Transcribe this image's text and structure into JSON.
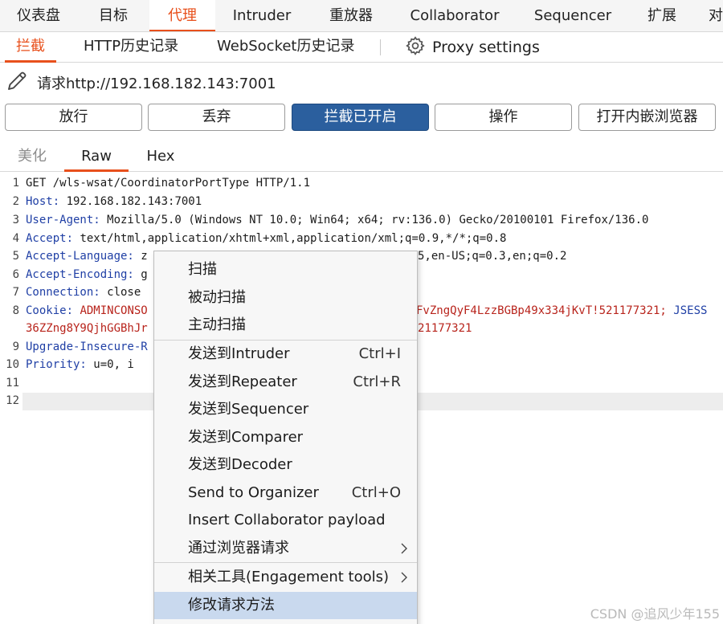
{
  "top_tabs": [
    {
      "label": "仪表盘"
    },
    {
      "label": "目标"
    },
    {
      "label": "代理"
    },
    {
      "label": "Intruder"
    },
    {
      "label": "重放器"
    },
    {
      "label": "Collaborator"
    },
    {
      "label": "Sequencer"
    },
    {
      "label": "扩展"
    },
    {
      "label": "对"
    }
  ],
  "active_top_tab": "代理",
  "sub_tabs": [
    {
      "label": "拦截"
    },
    {
      "label": "HTTP历史记录"
    },
    {
      "label": "WebSocket历史记录"
    }
  ],
  "active_sub_tab": "拦截",
  "proxy_settings": {
    "icon": "gear-icon",
    "label": "Proxy settings"
  },
  "request": {
    "icon": "pencil-icon",
    "label": "请求http://192.168.182.143:7001"
  },
  "buttons": {
    "forward": "放行",
    "drop": "丢弃",
    "intercept": "拦截已开启",
    "action": "操作",
    "browser": "打开内嵌浏览器"
  },
  "editor_tabs": [
    {
      "label": "美化"
    },
    {
      "label": "Raw"
    },
    {
      "label": "Hex"
    }
  ],
  "active_editor_tab": "Raw",
  "gutter": [
    "1",
    "2",
    "3",
    "4",
    "5",
    "6",
    "7",
    "8",
    "",
    "9",
    "10",
    "11",
    "12"
  ],
  "code": {
    "line1": "GET /wls-wsat/CoordinatorPortType HTTP/1.1",
    "line2_name": "Host:",
    "line2_value": " 192.168.182.143:7001",
    "line3_name": "User-Agent:",
    "line3_value": " Mozilla/5.0 (Windows NT 10.0; Win64; x64; rv:136.0) Gecko/20100101 Firefox/136.0",
    "line4_name": "Accept:",
    "line4_value": " text/html,application/xhtml+xml,application/xml;q=0.9,*/*;q=0.8",
    "line5_name": "Accept-Language:",
    "line5_value_left": " z",
    "line5_value_right": "5,en-US;q=0.3,en;q=0.2",
    "line6_name": "Accept-Encoding:",
    "line6_value": " g",
    "line7_name": "Connection:",
    "line7_value": " close",
    "line8_name": "Cookie:",
    "line8_value_left": " ADMINCONSO",
    "line8_value_right": "FvZngQyF4LzzBGBp49x334jKvT!521177321; ",
    "line8_name2": "JSESS",
    "line8b_left": "36ZZng8Y9QjhGGBhJr",
    "line8b_right": "21177321",
    "line9_name": "Upgrade-Insecure-R",
    "line10_name": "Priority:",
    "line10_value": " u=0, i"
  },
  "context_menu": [
    {
      "label": "扫描",
      "shortcut": ""
    },
    {
      "label": "被动扫描",
      "shortcut": ""
    },
    {
      "label": "主动扫描",
      "shortcut": ""
    },
    {
      "label": "发送到Intruder",
      "shortcut": "Ctrl+I"
    },
    {
      "label": "发送到Repeater",
      "shortcut": "Ctrl+R"
    },
    {
      "label": "发送到Sequencer",
      "shortcut": ""
    },
    {
      "label": "发送到Comparer",
      "shortcut": ""
    },
    {
      "label": "发送到Decoder",
      "shortcut": ""
    },
    {
      "label": "Send to Organizer",
      "shortcut": "Ctrl+O"
    },
    {
      "label": "Insert Collaborator payload",
      "shortcut": ""
    },
    {
      "label": "通过浏览器请求",
      "shortcut": "",
      "submenu": true
    },
    {
      "label": "相关工具(Engagement tools)",
      "shortcut": "",
      "submenu": true
    },
    {
      "label": "修改请求方法",
      "shortcut": "",
      "highlighted": true
    }
  ],
  "watermark": "CSDN @追风少年155",
  "colors": {
    "accent": "#e8501c",
    "primary_button": "#2b5f9e",
    "header_name": "#1f3fa5",
    "cookie_value": "#b8241c",
    "menu_highlight": "#c9d9ee"
  }
}
